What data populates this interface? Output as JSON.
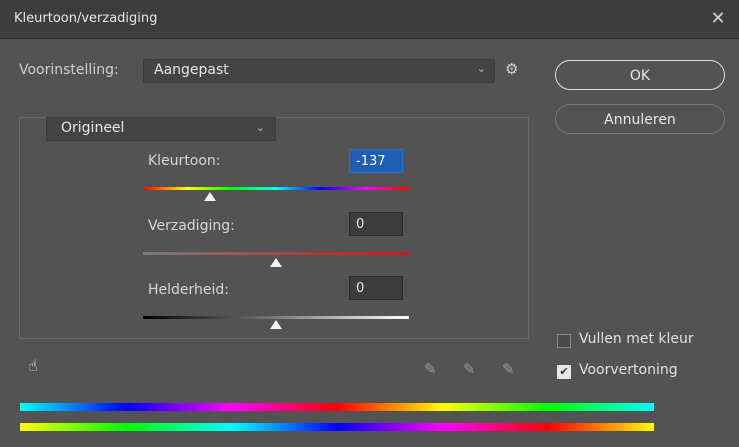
{
  "dialog": {
    "title": "Kleurtoon/verzadiging",
    "close_glyph": "✕"
  },
  "preset": {
    "label": "Voorinstelling:",
    "value": "Aangepast",
    "chevron": "⌄",
    "gear_glyph": "⚙"
  },
  "buttons": {
    "ok": "OK",
    "cancel": "Annuleren"
  },
  "range": {
    "value": "Origineel",
    "chevron": "⌄"
  },
  "hue": {
    "label": "Kleurtoon:",
    "value": "-137",
    "slider_fraction": 0.25
  },
  "saturation": {
    "label": "Verzadiging:",
    "value": "0",
    "slider_fraction": 0.5
  },
  "lightness": {
    "label": "Helderheid:",
    "value": "0",
    "slider_fraction": 0.5
  },
  "options": {
    "colorize_label": "Vullen met kleur",
    "colorize_checked": false,
    "preview_label": "Voorvertoning",
    "preview_checked": true,
    "check_glyph": "✔"
  },
  "icons": {
    "hand": "hand-target-icon",
    "hand_glyph": "☝",
    "eyedropper": "eyedropper-icon",
    "eyedropper_add": "eyedropper-plus-icon",
    "eyedropper_sub": "eyedropper-minus-icon",
    "eyedropper_glyph": "✎"
  },
  "colors": {
    "selection": "#1f5fb3",
    "background": "#535353",
    "titlebar": "#3d3d3d"
  }
}
